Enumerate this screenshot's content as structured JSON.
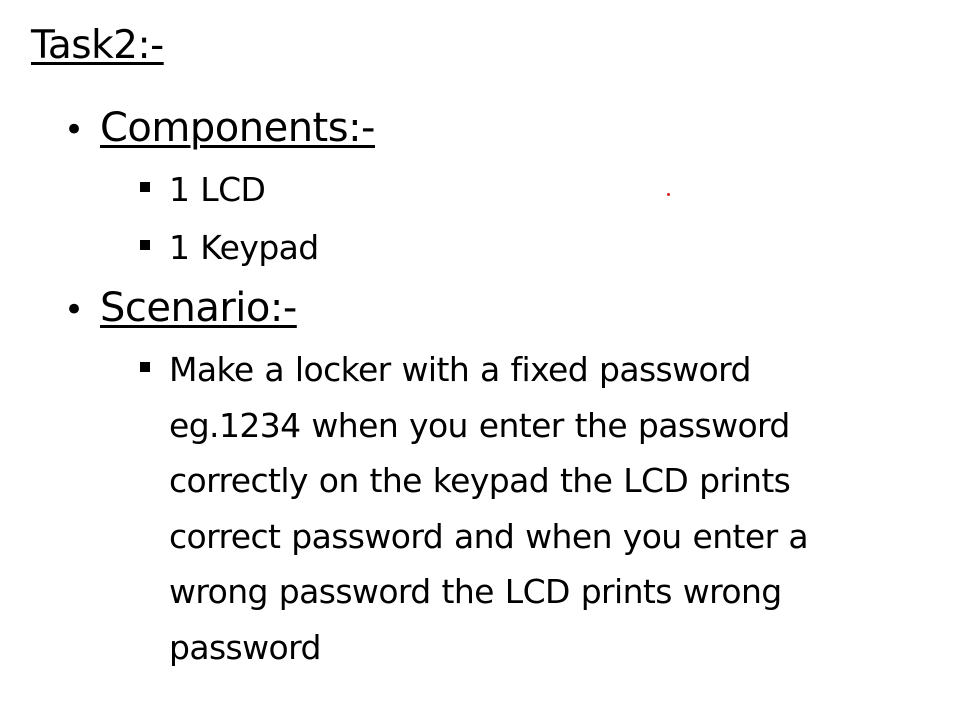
{
  "title": "Task2:-",
  "sections": [
    {
      "heading": "Components:-",
      "items": [
        "1 LCD",
        "1 Keypad"
      ]
    },
    {
      "heading": "Scenario:-",
      "items": [
        "Make a locker with a fixed password eg.1234 when you enter the password correctly on the keypad the LCD prints correct password and when you enter a wrong password the LCD prints wrong password"
      ]
    }
  ],
  "colors": {
    "text": "#000000",
    "stray_dot": "#d21f1f"
  }
}
